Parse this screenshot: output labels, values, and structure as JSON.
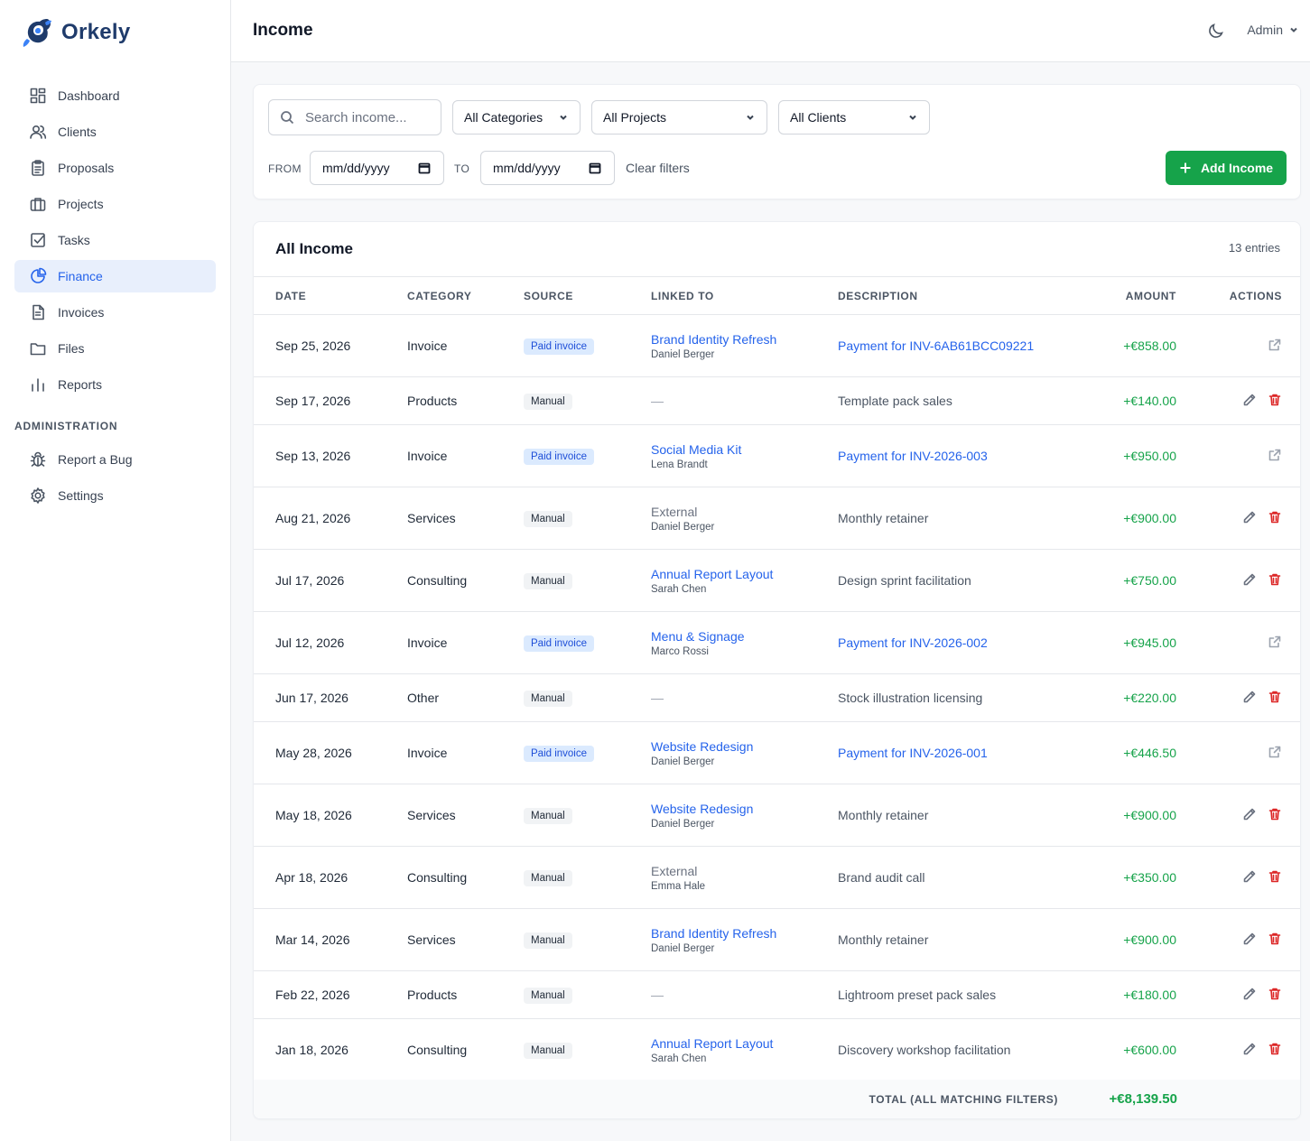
{
  "app": {
    "brand": "Orkely"
  },
  "sidebar": {
    "items": [
      {
        "label": "Dashboard",
        "icon": "dashboard-icon"
      },
      {
        "label": "Clients",
        "icon": "users-icon"
      },
      {
        "label": "Proposals",
        "icon": "clipboard-icon"
      },
      {
        "label": "Projects",
        "icon": "briefcase-icon"
      },
      {
        "label": "Tasks",
        "icon": "checkbox-icon"
      },
      {
        "label": "Finance",
        "icon": "pie-chart-icon",
        "active": true
      },
      {
        "label": "Invoices",
        "icon": "document-icon"
      },
      {
        "label": "Files",
        "icon": "folder-icon"
      },
      {
        "label": "Reports",
        "icon": "bar-chart-icon"
      }
    ],
    "admin_section": "ADMINISTRATION",
    "admin_items": [
      {
        "label": "Report a Bug",
        "icon": "bug-icon"
      },
      {
        "label": "Settings",
        "icon": "gear-icon"
      }
    ]
  },
  "header": {
    "title": "Income",
    "user": "Admin"
  },
  "filters": {
    "search_placeholder": "Search income...",
    "category": "All Categories",
    "project": "All Projects",
    "client": "All Clients",
    "from_label": "FROM",
    "to_label": "TO",
    "from_value": "mm/dd/yyyy",
    "to_value": "mm/dd/yyyy",
    "clear": "Clear filters",
    "add_button": "Add Income"
  },
  "table": {
    "title": "All Income",
    "entries": "13 entries",
    "columns": [
      "DATE",
      "CATEGORY",
      "SOURCE",
      "LINKED TO",
      "DESCRIPTION",
      "AMOUNT",
      "ACTIONS"
    ],
    "rows": [
      {
        "date": "Sep 25, 2026",
        "category": "Invoice",
        "source": "Paid invoice",
        "linked": "Brand Identity Refresh",
        "linked_sub": "Daniel Berger",
        "description": "Payment for INV-6AB61BCC09221",
        "amount": "+€858.00"
      },
      {
        "date": "Sep 17, 2026",
        "category": "Products",
        "source": "Manual",
        "linked": "—",
        "linked_sub": "",
        "description": "Template pack sales",
        "amount": "+€140.00"
      },
      {
        "date": "Sep 13, 2026",
        "category": "Invoice",
        "source": "Paid invoice",
        "linked": "Social Media Kit",
        "linked_sub": "Lena Brandt",
        "description": "Payment for INV-2026-003",
        "amount": "+€950.00"
      },
      {
        "date": "Aug 21, 2026",
        "category": "Services",
        "source": "Manual",
        "linked": "External",
        "linked_sub": "Daniel Berger",
        "description": "Monthly retainer",
        "amount": "+€900.00"
      },
      {
        "date": "Jul 17, 2026",
        "category": "Consulting",
        "source": "Manual",
        "linked": "Annual Report Layout",
        "linked_sub": "Sarah Chen",
        "description": "Design sprint facilitation",
        "amount": "+€750.00"
      },
      {
        "date": "Jul 12, 2026",
        "category": "Invoice",
        "source": "Paid invoice",
        "linked": "Menu & Signage",
        "linked_sub": "Marco Rossi",
        "description": "Payment for INV-2026-002",
        "amount": "+€945.00"
      },
      {
        "date": "Jun 17, 2026",
        "category": "Other",
        "source": "Manual",
        "linked": "—",
        "linked_sub": "",
        "description": "Stock illustration licensing",
        "amount": "+€220.00"
      },
      {
        "date": "May 28, 2026",
        "category": "Invoice",
        "source": "Paid invoice",
        "linked": "Website Redesign",
        "linked_sub": "Daniel Berger",
        "description": "Payment for INV-2026-001",
        "amount": "+€446.50"
      },
      {
        "date": "May 18, 2026",
        "category": "Services",
        "source": "Manual",
        "linked": "Website Redesign",
        "linked_sub": "Daniel Berger",
        "description": "Monthly retainer",
        "amount": "+€900.00"
      },
      {
        "date": "Apr 18, 2026",
        "category": "Consulting",
        "source": "Manual",
        "linked": "External",
        "linked_sub": "Emma Hale",
        "description": "Brand audit call",
        "amount": "+€350.00"
      },
      {
        "date": "Mar 14, 2026",
        "category": "Services",
        "source": "Manual",
        "linked": "Brand Identity Refresh",
        "linked_sub": "Daniel Berger",
        "description": "Monthly retainer",
        "amount": "+€900.00"
      },
      {
        "date": "Feb 22, 2026",
        "category": "Products",
        "source": "Manual",
        "linked": "—",
        "linked_sub": "",
        "description": "Lightroom preset pack sales",
        "amount": "+€180.00"
      },
      {
        "date": "Jan 18, 2026",
        "category": "Consulting",
        "source": "Manual",
        "linked": "Annual Report Layout",
        "linked_sub": "Sarah Chen",
        "description": "Discovery workshop facilitation",
        "amount": "+€600.00"
      }
    ],
    "total_label": "TOTAL (ALL MATCHING FILTERS)",
    "total_value": "+€8,139.50"
  },
  "colors": {
    "accent": "#2563eb",
    "positive": "#16a34a",
    "danger": "#dc2626",
    "brand": "#1f3b6b"
  }
}
